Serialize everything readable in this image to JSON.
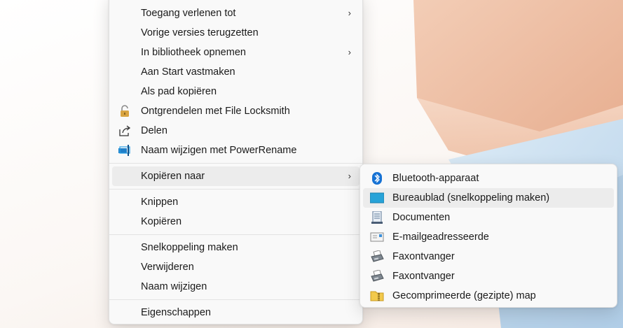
{
  "context_menu": {
    "items": [
      {
        "label": "Toegang verlenen tot",
        "icon": "",
        "submenu": true
      },
      {
        "label": "Vorige versies terugzetten",
        "icon": "",
        "submenu": false
      },
      {
        "label": "In bibliotheek opnemen",
        "icon": "",
        "submenu": true
      },
      {
        "label": "Aan Start vastmaken",
        "icon": "",
        "submenu": false
      },
      {
        "label": "Als pad kopiëren",
        "icon": "",
        "submenu": false
      },
      {
        "label": "Ontgrendelen met File Locksmith",
        "icon": "padlock-icon",
        "submenu": false
      },
      {
        "label": "Delen",
        "icon": "share-icon",
        "submenu": false
      },
      {
        "label": "Naam wijzigen met PowerRename",
        "icon": "powerrename-icon",
        "submenu": false
      },
      {
        "label": "Kopiëren naar",
        "icon": "",
        "submenu": true,
        "highlighted": true
      },
      {
        "label": "Knippen",
        "icon": "",
        "submenu": false
      },
      {
        "label": "Kopiëren",
        "icon": "",
        "submenu": false
      },
      {
        "label": "Snelkoppeling maken",
        "icon": "",
        "submenu": false
      },
      {
        "label": "Verwijderen",
        "icon": "",
        "submenu": false
      },
      {
        "label": "Naam wijzigen",
        "icon": "",
        "submenu": false
      },
      {
        "label": "Eigenschappen",
        "icon": "",
        "submenu": false
      }
    ],
    "chevron": "›"
  },
  "submenu": {
    "items": [
      {
        "label": "Bluetooth-apparaat",
        "icon": "bluetooth-icon"
      },
      {
        "label": "Bureaublad (snelkoppeling maken)",
        "icon": "desktop-icon",
        "highlighted": true
      },
      {
        "label": "Documenten",
        "icon": "documents-icon"
      },
      {
        "label": "E-mailgeadresseerde",
        "icon": "mail-recipient-icon"
      },
      {
        "label": "Faxontvanger",
        "icon": "fax-icon"
      },
      {
        "label": "Faxontvanger",
        "icon": "fax-icon"
      },
      {
        "label": "Gecomprimeerde (gezipte) map",
        "icon": "zip-folder-icon"
      }
    ]
  },
  "colors": {
    "menu_bg": "#f9f9f9",
    "highlight": "#ececec",
    "wallpaper_peach": "#e8b79c",
    "wallpaper_blue": "#c9def0"
  }
}
